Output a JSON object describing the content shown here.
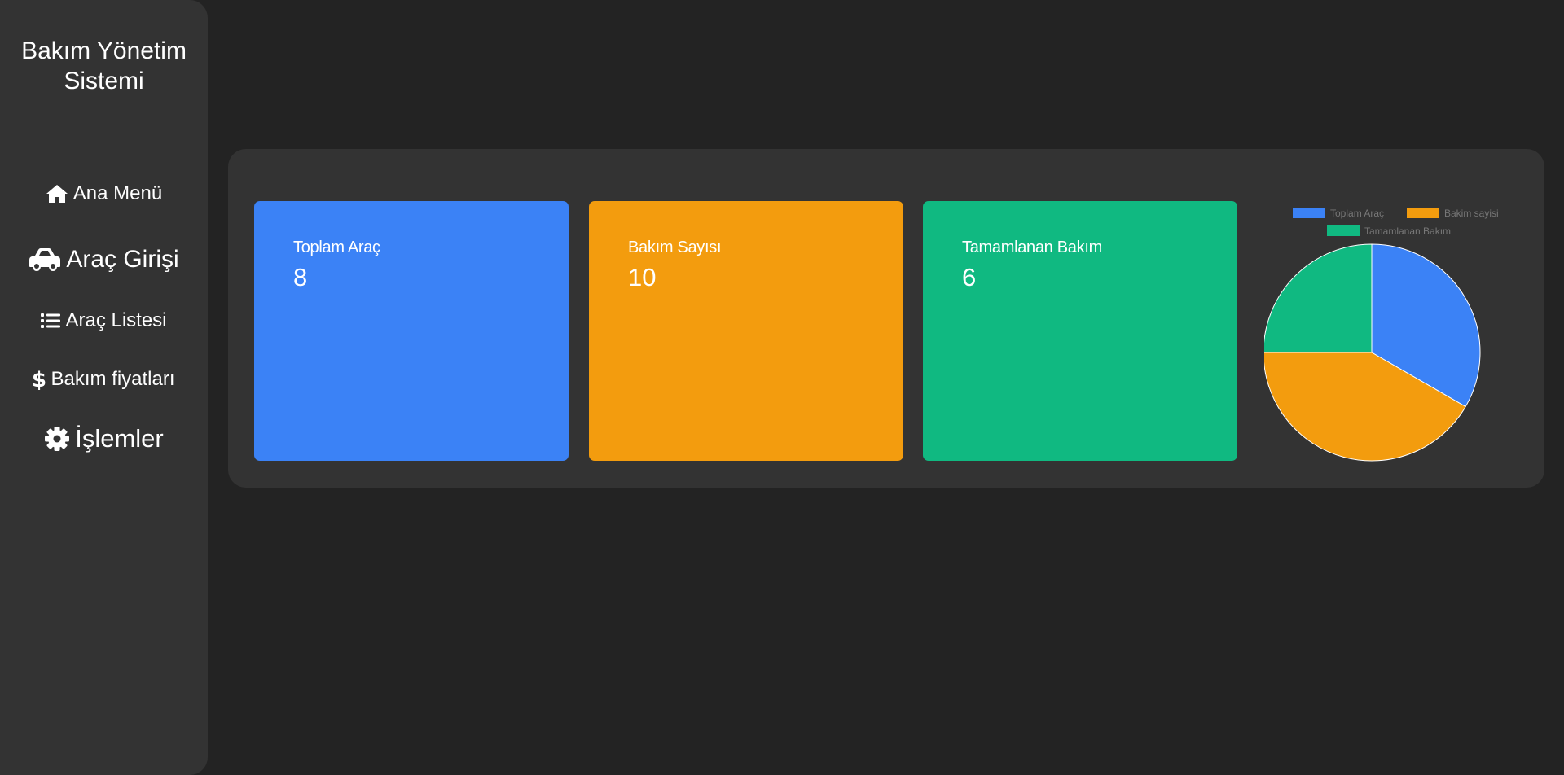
{
  "sidebar": {
    "title": "Bakım Yönetim Sistemi",
    "items": [
      {
        "label": "Ana Menü",
        "icon": "home-icon"
      },
      {
        "label": "Araç Girişi",
        "icon": "car-icon"
      },
      {
        "label": "Araç Listesi",
        "icon": "list-icon"
      },
      {
        "label": "Bakım fiyatları",
        "icon": "dollar-icon"
      },
      {
        "label": "İşlemler",
        "icon": "gear-icon"
      }
    ]
  },
  "cards": [
    {
      "title": "Toplam Araç",
      "value": "8",
      "color": "#3b82f6"
    },
    {
      "title": "Bakım Sayısı",
      "value": "10",
      "color": "#f39c0e"
    },
    {
      "title": "Tamamlanan Bakım",
      "value": "6",
      "color": "#10b981"
    }
  ],
  "chart_data": {
    "type": "pie",
    "categories": [
      "Toplam Araç",
      "Bakim sayisi",
      "Tamamlanan Bakım"
    ],
    "values": [
      8,
      10,
      6
    ],
    "colors": [
      "#3b82f6",
      "#f39c0e",
      "#10b981"
    ],
    "legend_position": "top"
  }
}
